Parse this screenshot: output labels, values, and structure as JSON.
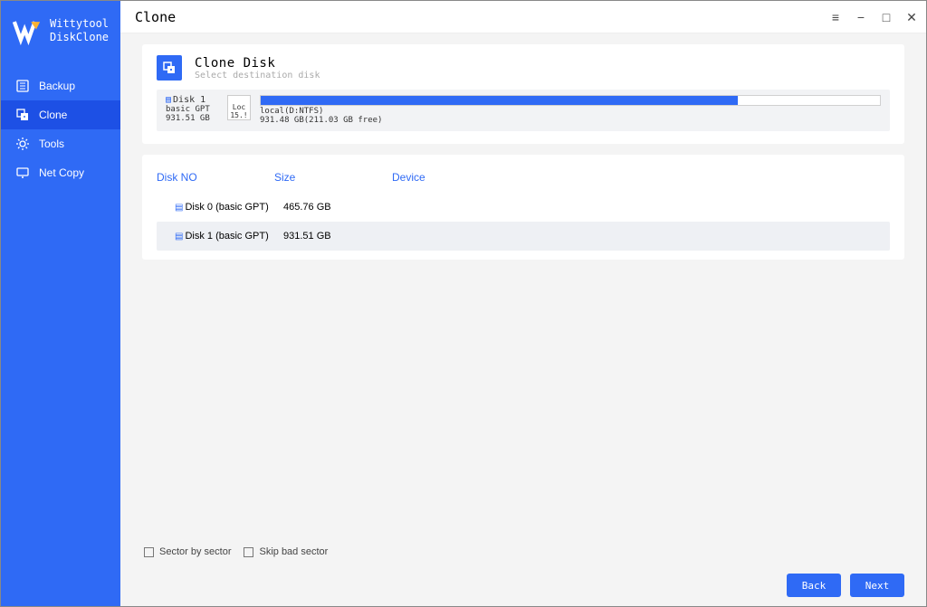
{
  "brand": {
    "line1": "Wittytool",
    "line2": "DiskClone"
  },
  "sidebar": {
    "items": [
      {
        "label": "Backup"
      },
      {
        "label": "Clone"
      },
      {
        "label": "Tools"
      },
      {
        "label": "Net Copy"
      }
    ]
  },
  "titlebar": {
    "title": "Clone"
  },
  "step": {
    "title": "Clone Disk",
    "subtitle": "Select destination disk"
  },
  "selected_disk": {
    "name": "Disk 1",
    "part_style": "basic GPT",
    "total": "931.51 GB",
    "small": {
      "label1": "Loc",
      "label2": "15.!"
    },
    "main_label": "local(D:NTFS)",
    "main_info": "931.48 GB(211.03 GB  free)",
    "fill_percent": 77
  },
  "disk_table": {
    "headers": {
      "no": "Disk NO",
      "size": "Size",
      "device": "Device"
    },
    "rows": [
      {
        "name": "Disk 0 (basic GPT)",
        "size": "465.76 GB",
        "device": "",
        "selected": false
      },
      {
        "name": "Disk 1 (basic GPT)",
        "size": "931.51 GB",
        "device": "",
        "selected": true
      }
    ]
  },
  "options": {
    "sector_by_sector": "Sector by sector",
    "skip_bad_sector": "Skip bad sector"
  },
  "buttons": {
    "back": "Back",
    "next": "Next"
  }
}
